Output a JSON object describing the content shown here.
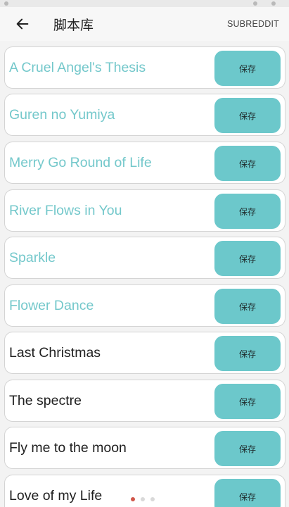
{
  "appbar": {
    "title": "脚本库",
    "action_label": "SUBREDDIT"
  },
  "list": {
    "items": [
      {
        "title": "A Cruel Angel's Thesis",
        "save_label": "保存",
        "style": "teal"
      },
      {
        "title": "Guren no Yumiya",
        "save_label": "保存",
        "style": "teal"
      },
      {
        "title": "Merry Go Round of Life",
        "save_label": "保存",
        "style": "teal"
      },
      {
        "title": "River Flows in You",
        "save_label": "保存",
        "style": "teal"
      },
      {
        "title": "Sparkle",
        "save_label": "保存",
        "style": "teal"
      },
      {
        "title": "Flower Dance",
        "save_label": "保存",
        "style": "teal"
      },
      {
        "title": "Last Christmas",
        "save_label": "保存",
        "style": "dark"
      },
      {
        "title": "The spectre",
        "save_label": "保存",
        "style": "dark"
      },
      {
        "title": "Fly me to the moon",
        "save_label": "保存",
        "style": "dark"
      },
      {
        "title": "Love of my Life",
        "save_label": "保存",
        "style": "dark"
      }
    ]
  },
  "colors": {
    "accent": "#6cc8cb",
    "teal_text": "#74c8cb",
    "page_indicator_active": "#d0564a"
  },
  "icons": {
    "back": "arrow-left-icon"
  }
}
